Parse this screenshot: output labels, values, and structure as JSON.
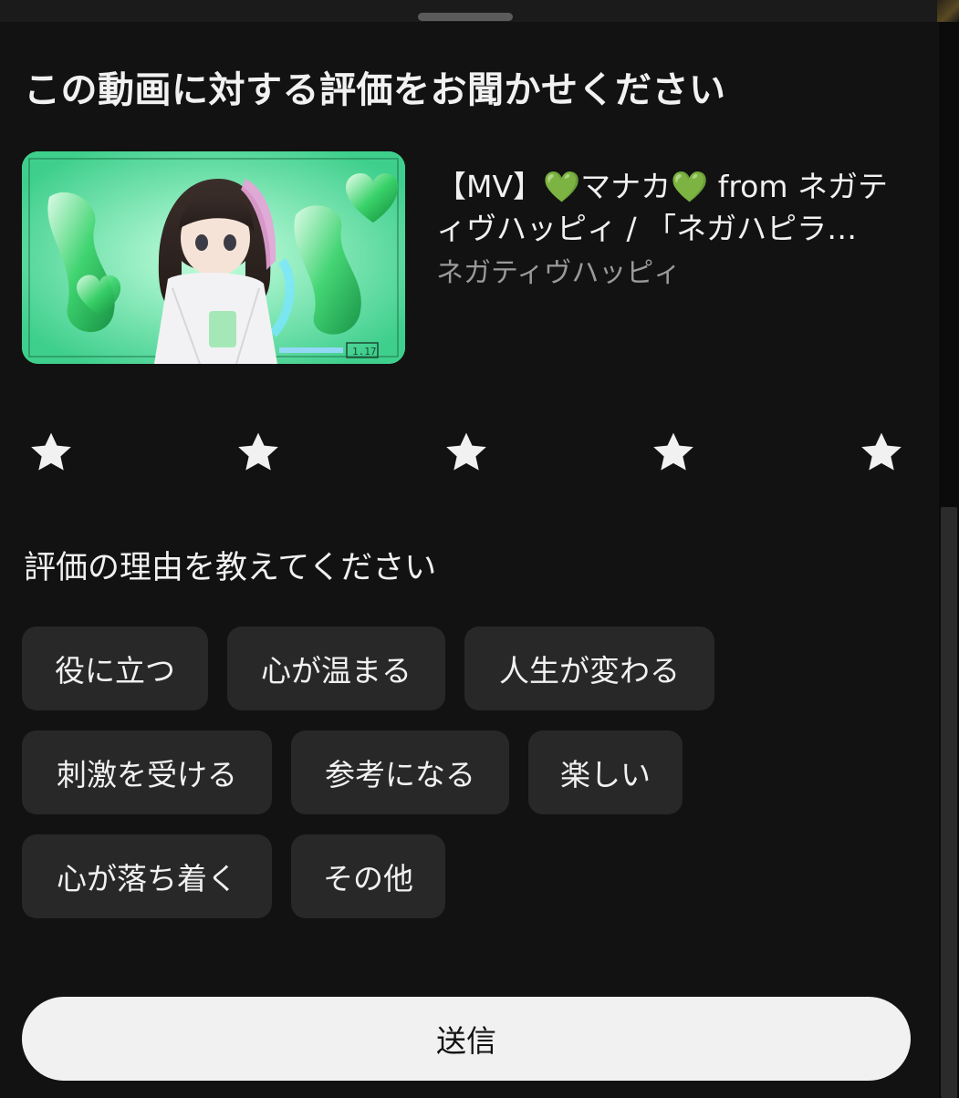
{
  "dialog": {
    "title": "この動画に対する評価をお聞かせください"
  },
  "video": {
    "title": "【MV】💚マナカ💚 from ネガティヴハッピィ / 「ネガハピラ…",
    "title_parts": [
      "【MV】",
      "💚",
      "マナカ",
      "💚",
      " from ネガティヴハッピィ / 「ネガハピラ…"
    ],
    "channel": "ネガティヴハッピィ",
    "thumbnail_icon": "music-video-thumbnail-image",
    "thumbnail_text": {
      "date": "1.17"
    }
  },
  "rating": {
    "max": 5,
    "value": 0,
    "star_icon": "star-icon",
    "star_color": "#f1f1f1"
  },
  "reasons": {
    "heading": "評価の理由を教えてください",
    "options": [
      "役に立つ",
      "心が温まる",
      "人生が変わる",
      "刺激を受ける",
      "参考になる",
      "楽しい",
      "心が落ち着く",
      "その他"
    ]
  },
  "actions": {
    "submit_label": "送信"
  },
  "colors": {
    "sheet_background": "#121212",
    "chip_background": "#282828",
    "button_background": "#f1f1f1",
    "heart_green": "#1faa3e",
    "secondary_text": "#9a9a9a"
  }
}
